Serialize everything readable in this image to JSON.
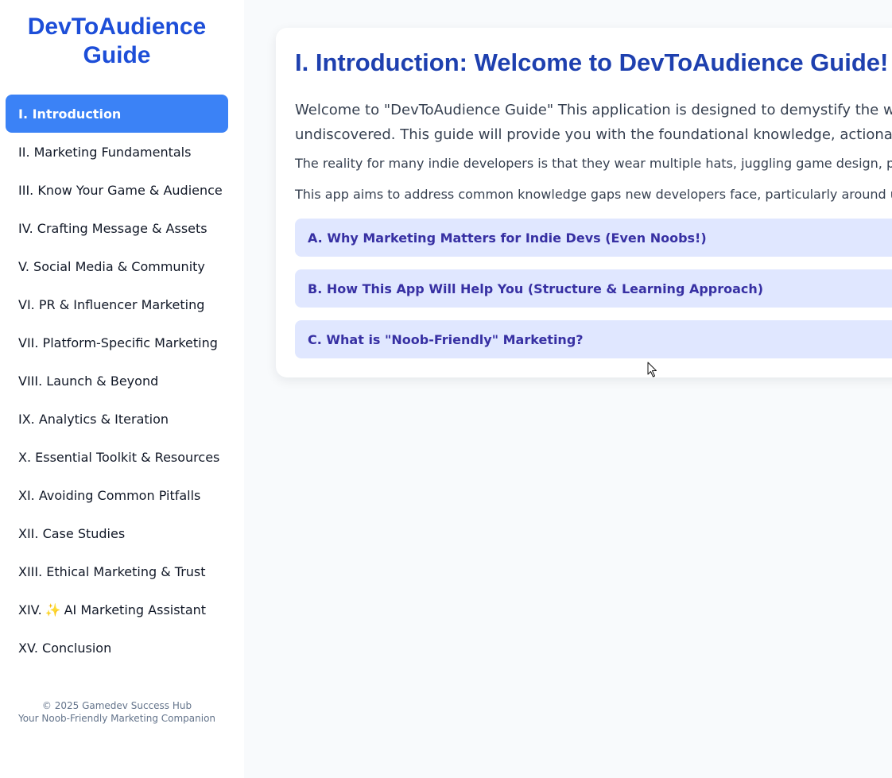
{
  "sidebar": {
    "brand_line1": "DevToAudience",
    "brand_line2": "Guide",
    "items": [
      {
        "label": "I. Introduction"
      },
      {
        "label": "II. Marketing Fundamentals"
      },
      {
        "label": "III. Know Your Game & Audience"
      },
      {
        "label": "IV. Crafting Message & Assets"
      },
      {
        "label": "V. Social Media & Community"
      },
      {
        "label": "VI. PR & Influencer Marketing"
      },
      {
        "label": "VII. Platform-Specific Marketing"
      },
      {
        "label": "VIII. Launch & Beyond"
      },
      {
        "label": "IX. Analytics & Iteration"
      },
      {
        "label": "X. Essential Toolkit & Resources"
      },
      {
        "label": "XI. Avoiding Common Pitfalls"
      },
      {
        "label": "XII. Case Studies"
      },
      {
        "label": "XIII. Ethical Marketing & Trust"
      },
      {
        "label_prefix": "XIV.",
        "icon": "✨",
        "label_suffix": "AI Marketing Assistant"
      },
      {
        "label": "XV. Conclusion"
      }
    ],
    "footer_line1": "© 2025 Gamedev Success Hub",
    "footer_line2": "Your Noob-Friendly Marketing Companion"
  },
  "main": {
    "title": "I. Introduction: Welcome to DevToAudience Guide!",
    "para1_line1": "Welcome to \"DevToAudience Guide\" This application is designed to demystify the world",
    "para1_line2": "undiscovered. This guide will provide you with the foundational knowledge, actionable st",
    "para2": "The reality for many indie developers is that they wear multiple hats, juggling game design, program",
    "para3": "This app aims to address common knowledge gaps new developers face, particularly around under",
    "accordions": [
      {
        "label": "A. Why Marketing Matters for Indie Devs (Even Noobs!)"
      },
      {
        "label": "B. How This App Will Help You (Structure & Learning Approach)"
      },
      {
        "label": "C. What is \"Noob-Friendly\" Marketing?"
      }
    ]
  },
  "colors": {
    "brand": "#1d4ed8",
    "active_nav": "#3b82f6",
    "title": "#1e40af",
    "accordion_bg": "#e0e7ff",
    "accordion_text": "#3730a3"
  }
}
